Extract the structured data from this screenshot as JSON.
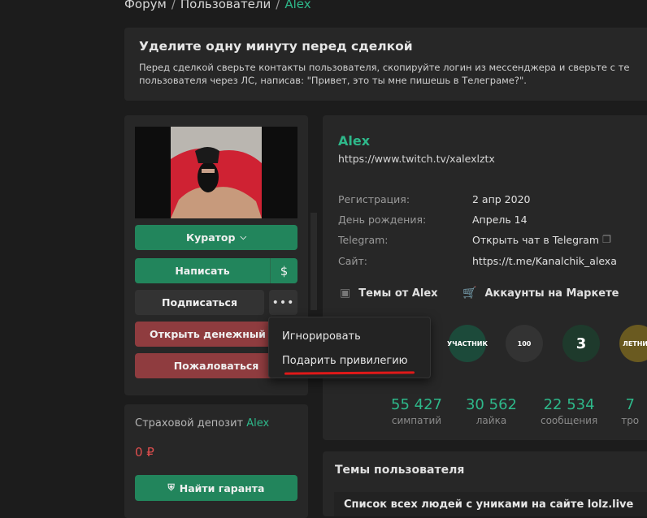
{
  "breadcrumb": {
    "items": [
      "Форум",
      "Пользователи"
    ],
    "current": "Alex",
    "separator": "/"
  },
  "notice": {
    "title": "Уделите одну минуту перед сделкой",
    "line1": "Перед сделкой сверьте контакты пользователя, скопируйте логин из мессенджера и сверьте с те",
    "line2": "пользователя через ЛС, написав: \"Привет, это ты мне пишешь в Телеграме?\"."
  },
  "sidebar": {
    "curator_label": "Куратор",
    "write_label": "Написать",
    "dollar_symbol": "$",
    "subscribe_label": "Подписаться",
    "more_symbol": "•••",
    "dispute_label": "Открыть денежный спор",
    "report_label": "Пожаловаться"
  },
  "deposit": {
    "label": "Страховой депозит",
    "user": "Alex",
    "amount": "0 ₽",
    "find_guarantor_label": "Найти гаранта"
  },
  "profile": {
    "username": "Alex",
    "link": "https://www.twitch.tv/xalexlztx",
    "fields": [
      {
        "key": "Регистрация:",
        "value": "2 апр 2020"
      },
      {
        "key": "День рождения:",
        "value": "Апрель 14"
      },
      {
        "key": "Telegram:",
        "value": "Открыть чат в Telegram"
      },
      {
        "key": "Сайт:",
        "value": "https://t.me/Kanalchik_alexa"
      }
    ],
    "tab_threads": "Темы от Alex",
    "tab_market": "Аккаунты на Маркете"
  },
  "badges": [
    {
      "name": "участник-badge",
      "label": "УЧАСТНИК",
      "color": "#1c4a3a"
    },
    {
      "name": "100-reviews-badge",
      "label": "100",
      "color": "#333"
    },
    {
      "name": "3-years-badge",
      "label": "3",
      "color": "#1e3a2c"
    },
    {
      "name": "summer-badge",
      "label": "ЛЕТНИЙ",
      "color": "#6a5a20"
    }
  ],
  "stats": [
    {
      "value": "55 427",
      "label": "симпатий"
    },
    {
      "value": "30 562",
      "label": "лайка"
    },
    {
      "value": "22 534",
      "label": "сообщения"
    },
    {
      "value": "7",
      "label": "тро"
    }
  ],
  "user_threads": {
    "title": "Темы пользователя",
    "first_item": "Список всех людей с униками на сайте lolz.live"
  },
  "dropdown": {
    "ignore_label": "Игнорировать",
    "gift_label": "Подарить привилегию"
  },
  "colors": {
    "accent": "#2eb88a",
    "green_button": "#22855c",
    "red_button": "#8f3c3f",
    "annotation": "#e01919"
  }
}
